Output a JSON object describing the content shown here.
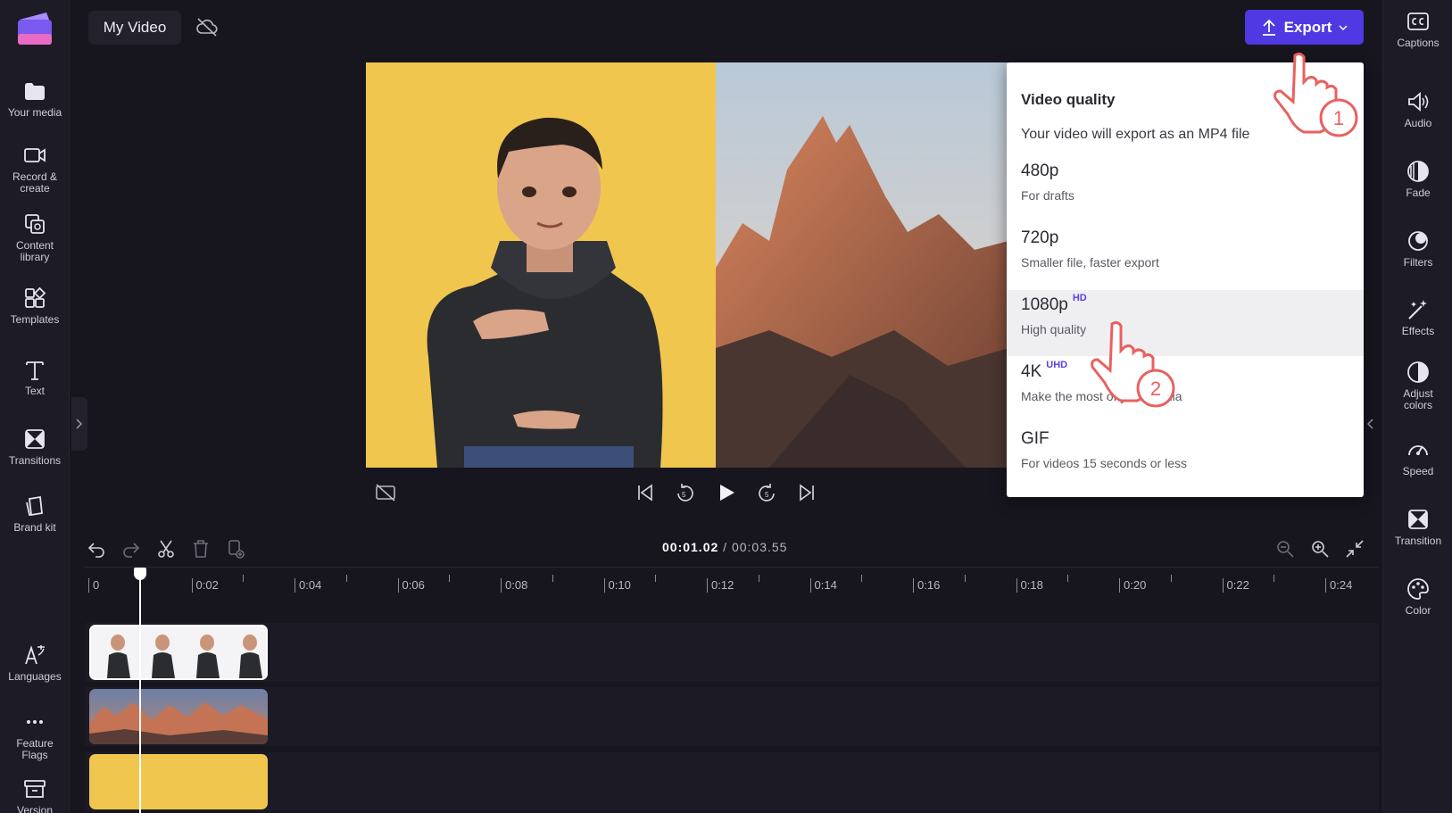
{
  "project": {
    "title": "My Video"
  },
  "export": {
    "label": "Export"
  },
  "left_sidebar": [
    {
      "label": "Your media",
      "icon": "folder-icon"
    },
    {
      "label": "Record &\ncreate",
      "icon": "camera-icon"
    },
    {
      "label": "Content\nlibrary",
      "icon": "library-icon"
    },
    {
      "label": "Templates",
      "icon": "templates-icon"
    },
    {
      "label": "Text",
      "icon": "text-icon"
    },
    {
      "label": "Transitions",
      "icon": "transitions-icon"
    },
    {
      "label": "Brand kit",
      "icon": "brand-kit-icon"
    },
    {
      "label": "Languages",
      "icon": "languages-icon"
    },
    {
      "label": "Feature\nFlags",
      "icon": "more-icon"
    },
    {
      "label": "Version",
      "icon": "archive-icon"
    }
  ],
  "right_sidebar": [
    {
      "label": "Captions",
      "icon": "cc-icon"
    },
    {
      "label": "Audio",
      "icon": "speaker-icon"
    },
    {
      "label": "Fade",
      "icon": "fade-icon"
    },
    {
      "label": "Filters",
      "icon": "filters-icon"
    },
    {
      "label": "Effects",
      "icon": "wand-icon"
    },
    {
      "label": "Adjust\ncolors",
      "icon": "contrast-icon"
    },
    {
      "label": "Speed",
      "icon": "speedometer-icon"
    },
    {
      "label": "Transition",
      "icon": "transition-icon"
    },
    {
      "label": "Color",
      "icon": "palette-icon"
    }
  ],
  "quality_menu": {
    "heading": "Video quality",
    "subheading": "Your video will export as an MP4 file",
    "options": [
      {
        "name": "480p",
        "badge": "",
        "desc": "For drafts"
      },
      {
        "name": "720p",
        "badge": "",
        "desc": "Smaller file, faster export"
      },
      {
        "name": "1080p",
        "badge": "HD",
        "desc": "High quality",
        "selected": true
      },
      {
        "name": "4K",
        "badge": "UHD",
        "desc": "Make the most of your media"
      },
      {
        "name": "GIF",
        "badge": "",
        "desc": "For videos 15 seconds or less"
      }
    ]
  },
  "annotations": {
    "step1": "1",
    "step2": "2"
  },
  "timeline": {
    "current_time": "00:01.02",
    "separator": " / ",
    "total_time": "00:03.55",
    "ticks": [
      "0",
      "0:02",
      "0:04",
      "0:06",
      "0:08",
      "0:10",
      "0:12",
      "0:14",
      "0:16",
      "0:18",
      "0:20",
      "0:22",
      "0:24"
    ]
  },
  "colors": {
    "accent": "#4f39e3",
    "badge": "#5b3fe6",
    "background_clip": "#f1c64f",
    "annotation": "#e8615f"
  }
}
